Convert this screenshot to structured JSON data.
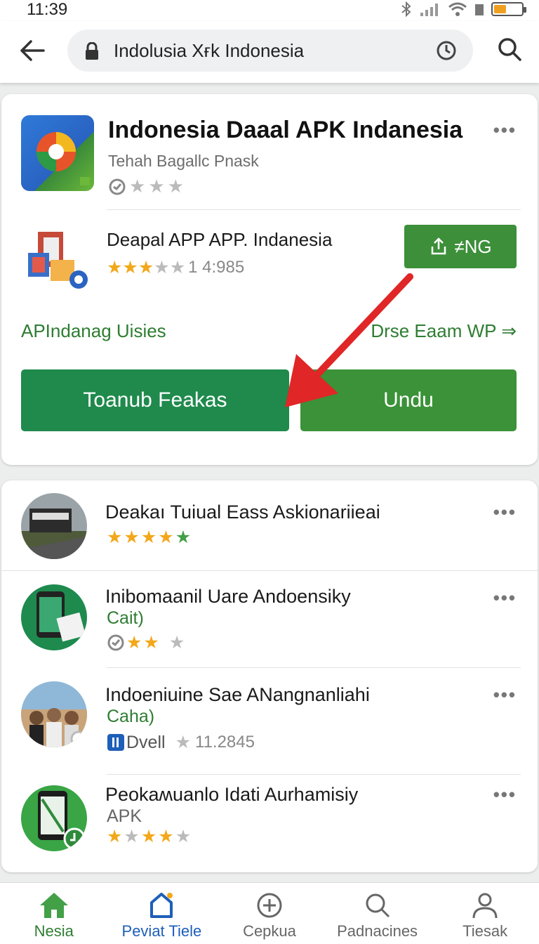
{
  "status": {
    "time": "11:39"
  },
  "browser": {
    "url": "Indolusia Xғk Indonesia"
  },
  "main_app": {
    "title": "Indonesia Daaal APK Indanesia",
    "subtitle": "Tehah Bagallc Pnask",
    "more": "•••"
  },
  "second_app": {
    "title": "Deapal APP APP. Indanesia",
    "rating_text": "1 4:985",
    "install_label": "≠NG"
  },
  "links": {
    "left": "APIndanag Uisies",
    "right": "Drse Eaam WP ⇒"
  },
  "buttons": {
    "left": "Toanub Feakas",
    "right": "Undu"
  },
  "list": [
    {
      "title": "Deakaı Tuiual Eass Askionariieai",
      "sub": "",
      "rating_text": ""
    },
    {
      "title": "Inibomaanil Uare Andoensiky",
      "sub": "Cait)",
      "rating_text": ""
    },
    {
      "title": "Indoeniuine Sae ANangnanliahi",
      "sub": "Caha)",
      "badge": "Dvell",
      "rating_text": "11.2845"
    },
    {
      "title": "Peokaʍuanlo Idati  Aurhamisiy",
      "sub": "APK",
      "rating_text": ""
    }
  ],
  "nav": [
    {
      "label": "Nesia"
    },
    {
      "label": "Peviat Tiele"
    },
    {
      "label": "Cepkua"
    },
    {
      "label": "Padnacines"
    },
    {
      "label": "Tiesak"
    }
  ],
  "colors": {
    "green": "#2e7d32",
    "button_dark": "#1f8a4c",
    "button_light": "#3b9238",
    "arrow": "#e02626",
    "star": "#f2a81a"
  }
}
